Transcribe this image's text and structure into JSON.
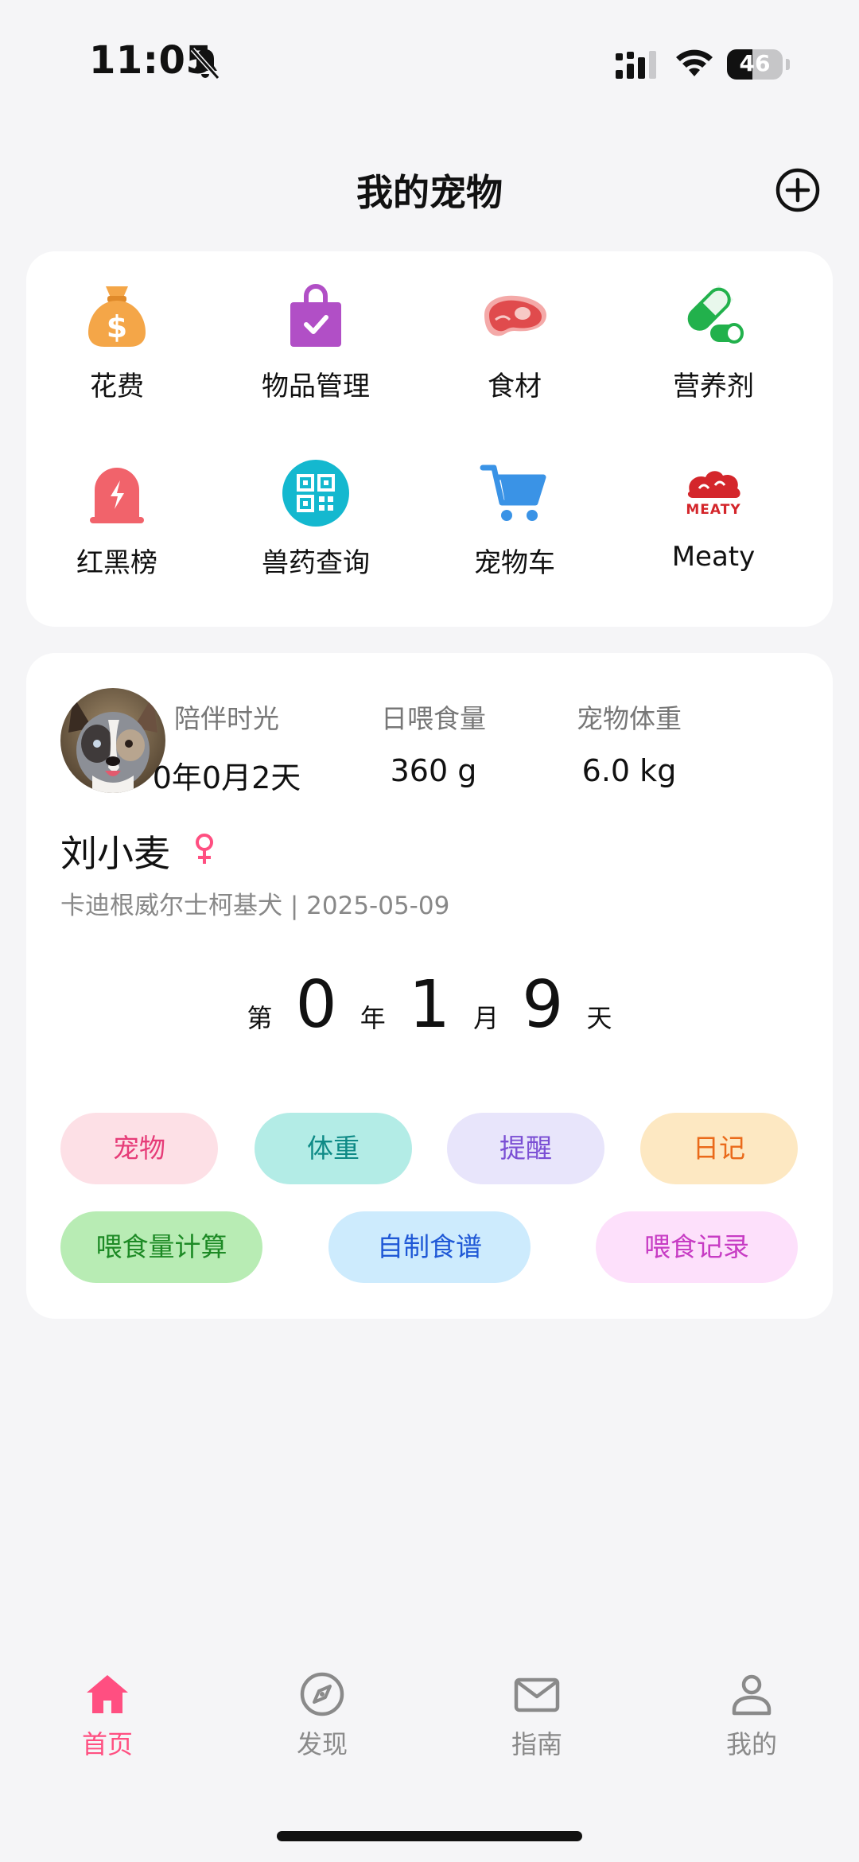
{
  "status_bar": {
    "time": "11:05",
    "battery_level": "46",
    "battery_fraction": 0.46
  },
  "header": {
    "title": "我的宠物"
  },
  "features": [
    {
      "label": "花费",
      "icon": "money-bag-icon",
      "color": "#f4a648"
    },
    {
      "label": "物品管理",
      "icon": "shopping-bag-icon",
      "color": "#b14fc6"
    },
    {
      "label": "食材",
      "icon": "meat-icon",
      "color": "#e8585a"
    },
    {
      "label": "营养剂",
      "icon": "pill-icon",
      "color": "#22b14c"
    },
    {
      "label": "红黑榜",
      "icon": "alert-bell-icon",
      "color": "#f1636b"
    },
    {
      "label": "兽药查询",
      "icon": "qr-code-icon",
      "color": "#14b8cf"
    },
    {
      "label": "宠物车",
      "icon": "cart-icon",
      "color": "#3a93e6"
    },
    {
      "label": "Meaty",
      "icon": "meaty-logo-icon",
      "color": "#d4262b"
    }
  ],
  "pet": {
    "name": "刘小麦",
    "gender_symbol": "♀",
    "breed_and_birthday": "卡迪根威尔士柯基犬 | 2025-05-09",
    "stats": [
      {
        "label": "陪伴时光",
        "value": "0年0月2天"
      },
      {
        "label": "日喂食量",
        "value": "360 g"
      },
      {
        "label": "宠物体重",
        "value": "6.0 kg"
      }
    ],
    "age": {
      "prefix": "第",
      "years": "0",
      "year_unit": "年",
      "months": "1",
      "month_unit": "月",
      "days": "9",
      "day_unit": "天"
    },
    "actions_row1": [
      {
        "label": "宠物",
        "bg": "#fde0e6",
        "fg": "#e63c78"
      },
      {
        "label": "体重",
        "bg": "#b3ece6",
        "fg": "#0e8a86"
      },
      {
        "label": "提醒",
        "bg": "#e8e5fb",
        "fg": "#7b4fd4"
      },
      {
        "label": "日记",
        "bg": "#fde8c2",
        "fg": "#ea6a1a"
      }
    ],
    "actions_row2": [
      {
        "label": "喂食量计算",
        "bg": "#b8ecb4",
        "fg": "#1d8a25"
      },
      {
        "label": "自制食谱",
        "bg": "#cdebfd",
        "fg": "#1f58d6"
      },
      {
        "label": "喂食记录",
        "bg": "#fde0fb",
        "fg": "#c73cc4"
      }
    ]
  },
  "nav": [
    {
      "label": "首页",
      "icon": "home-icon",
      "active": true
    },
    {
      "label": "发现",
      "icon": "compass-icon",
      "active": false
    },
    {
      "label": "指南",
      "icon": "mail-icon",
      "active": false
    },
    {
      "label": "我的",
      "icon": "profile-icon",
      "active": false
    }
  ],
  "colors": {
    "accent": "#ff4f81",
    "background": "#f5f5f7"
  }
}
